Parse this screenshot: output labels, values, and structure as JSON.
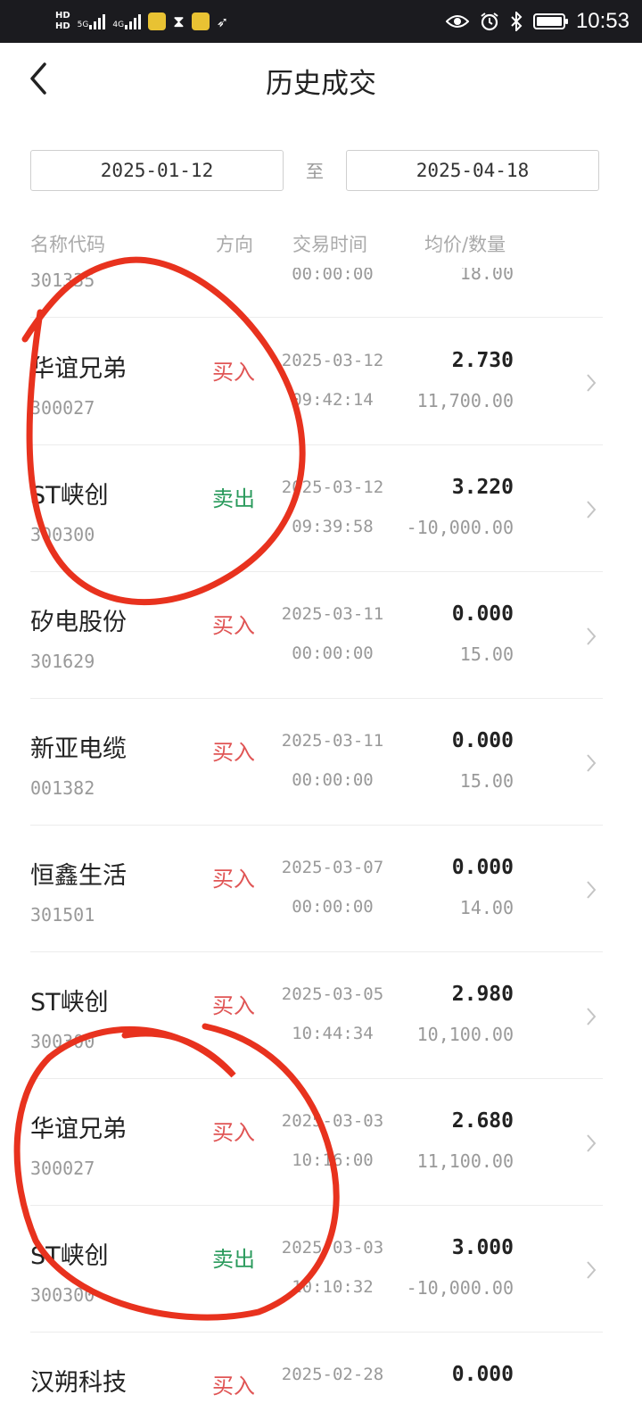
{
  "status_bar": {
    "hd1": "HD",
    "hd2": "HD",
    "net1": "5G",
    "net2": "4G",
    "time": "10:53",
    "icons": [
      "eye-icon",
      "alarm-icon",
      "bluetooth-icon",
      "battery-icon"
    ]
  },
  "nav": {
    "back_icon": "chevron-left-icon",
    "title": "历史成交"
  },
  "date_range": {
    "from": "2025-01-12",
    "separator": "至",
    "to": "2025-04-18"
  },
  "columns": {
    "name": "名称代码",
    "direction": "方向",
    "time": "交易时间",
    "price_qty": "均价/数量"
  },
  "partial_row": {
    "code": "301335",
    "time": "00:00:00",
    "qty": "18.00"
  },
  "rows": [
    {
      "name": "华谊兄弟",
      "code": "300027",
      "direction": "买入",
      "side": "buy",
      "date": "2025-03-12",
      "time": "09:42:14",
      "price": "2.730",
      "qty": "11,700.00"
    },
    {
      "name": "ST峡创",
      "code": "300300",
      "direction": "卖出",
      "side": "sell",
      "date": "2025-03-12",
      "time": "09:39:58",
      "price": "3.220",
      "qty": "-10,000.00"
    },
    {
      "name": "矽电股份",
      "code": "301629",
      "direction": "买入",
      "side": "buy",
      "date": "2025-03-11",
      "time": "00:00:00",
      "price": "0.000",
      "qty": "15.00"
    },
    {
      "name": "新亚电缆",
      "code": "001382",
      "direction": "买入",
      "side": "buy",
      "date": "2025-03-11",
      "time": "00:00:00",
      "price": "0.000",
      "qty": "15.00"
    },
    {
      "name": "恒鑫生活",
      "code": "301501",
      "direction": "买入",
      "side": "buy",
      "date": "2025-03-07",
      "time": "00:00:00",
      "price": "0.000",
      "qty": "14.00"
    },
    {
      "name": "ST峡创",
      "code": "300300",
      "direction": "买入",
      "side": "buy",
      "date": "2025-03-05",
      "time": "10:44:34",
      "price": "2.980",
      "qty": "10,100.00"
    },
    {
      "name": "华谊兄弟",
      "code": "300027",
      "direction": "买入",
      "side": "buy",
      "date": "2025-03-03",
      "time": "10:16:00",
      "price": "2.680",
      "qty": "11,100.00"
    },
    {
      "name": "ST峡创",
      "code": "300300",
      "direction": "卖出",
      "side": "sell",
      "date": "2025-03-03",
      "time": "10:10:32",
      "price": "3.000",
      "qty": "-10,000.00"
    },
    {
      "name": "汉朔科技",
      "code": "",
      "direction": "买入",
      "side": "buy",
      "date": "2025-02-28",
      "time": "",
      "price": "0.000",
      "qty": ""
    }
  ],
  "colors": {
    "buy": "#e05555",
    "sell": "#2a9a5c",
    "annotation": "#e8321e"
  }
}
